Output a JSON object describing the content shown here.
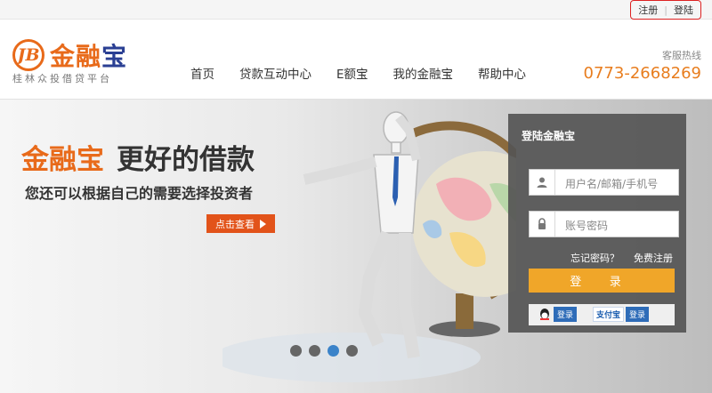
{
  "topbar": {
    "register": "注册",
    "login": "登陆"
  },
  "logo": {
    "mark": "JB",
    "name_orange": "金融",
    "name_blue": "宝",
    "subtitle": "桂林众投借贷平台"
  },
  "nav": {
    "items": [
      {
        "label": "首页"
      },
      {
        "label": "贷款互动中心"
      },
      {
        "label": "E额宝"
      },
      {
        "label": "我的金融宝"
      },
      {
        "label": "帮助中心"
      }
    ]
  },
  "hotline": {
    "label": "客服热线",
    "number": "0773-2668269"
  },
  "banner": {
    "headline_brand": "金融宝",
    "headline_rest": "更好的借款",
    "subline": "您还可以根据自己的需要选择投资者",
    "cta": "点击查看",
    "slides_total": 4,
    "slide_active": 3
  },
  "login_panel": {
    "title": "登陆金融宝",
    "username_placeholder": "用户名/邮箱/手机号",
    "password_placeholder": "账号密码",
    "forgot": "忘记密码？",
    "register": "免费注册",
    "submit": "登 录",
    "qq_login": "登录",
    "alipay_logo": "支付宝",
    "alipay_login": "登录"
  },
  "colors": {
    "brand_orange": "#e86a1a",
    "brand_blue": "#2a3f93",
    "login_button": "#f0a629",
    "cta": "#e2531a",
    "active_dot": "#3b83c9"
  },
  "icons": [
    "user-icon",
    "lock-icon",
    "qq-icon",
    "play-triangle-icon",
    "globe-illustration",
    "mannequin-illustration"
  ]
}
